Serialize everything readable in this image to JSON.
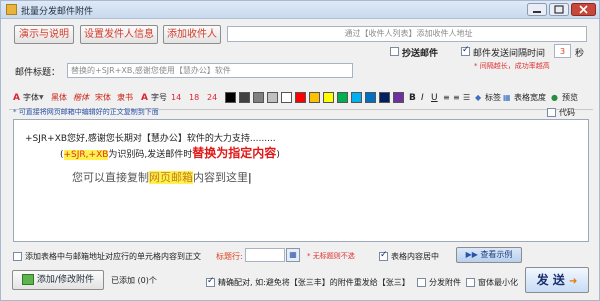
{
  "window": {
    "title": "批量分发邮件附件"
  },
  "toolbar_buttons": {
    "demo": "演示与说明",
    "sender_info": "设置发件人信息",
    "add_recipient": "添加收件人"
  },
  "recipients": {
    "value": "通过【收件人列表】添加收件人地址"
  },
  "options_top": {
    "cc_label": "抄送邮件",
    "cc_checked": false,
    "interval_label": "邮件发送间隔时间",
    "interval_checked": true,
    "interval_value": "3",
    "interval_unit": "秒",
    "hint": "* 间隔越长，成功率越高"
  },
  "subject": {
    "label": "邮件标题：",
    "value": "替换的+SJR+XB,感谢您使用【慧办公】软件"
  },
  "format_toolbar": {
    "font_label": "字体",
    "font_sample_1": "黑体",
    "font_sample_2": "楷体",
    "font_sample_3": "宋体",
    "font_sample_4": "隶书",
    "size_label": "字号",
    "size_1": "14",
    "size_2": "18",
    "size_3": "24",
    "tag_label": "标签",
    "table_width_label": "表格宽度",
    "preview_label": "预览",
    "code_label": "代码",
    "swatches": [
      "#000000",
      "#404040",
      "#808080",
      "#c0c0c0",
      "#ffffff",
      "#ff0000",
      "#ffc000",
      "#ffff00",
      "#00b050",
      "#00b0f0",
      "#0070c0",
      "#002060",
      "#7030a0"
    ]
  },
  "hint_line": "* 可直接将网页邮箱中编辑好的正文复制到下面",
  "editor": {
    "line1_prefix": "+SJR+XB您好,感谢您长期对【慧办公】软件的大力支持.........",
    "line2_open": "(",
    "line2_highlight": "+SJR,+XB",
    "line2_mid": "为识别码,发送邮件时",
    "line2_red": "替换为指定内容",
    "line2_close": ")",
    "line3_prefix": "您可以直接复制",
    "line3_highlight": "网页邮箱",
    "line3_suffix": "内容到这里"
  },
  "bottom_row": {
    "table_map_label": "添加表格中与邮箱地址对应行的单元格内容到正文",
    "table_map_checked": false,
    "header_row_label": "标题行:",
    "header_row_value": "",
    "header_row_note": "* 无标题则不选",
    "table_in_body_label": "表格内容居中",
    "table_in_body_checked": true,
    "view_example": "查看示例"
  },
  "footer": {
    "attach_button": "添加/修改附件",
    "attached_count": "已添加 (0)个",
    "exact_match_label": "精确配对, 如:避免将【张三丰】的附件重发给【张三】",
    "exact_match_checked": true,
    "split_attachments_label": "分发附件",
    "split_attachments_checked": false,
    "minimize_label": "窗体最小化",
    "minimize_checked": false,
    "send_button": "发 送"
  }
}
